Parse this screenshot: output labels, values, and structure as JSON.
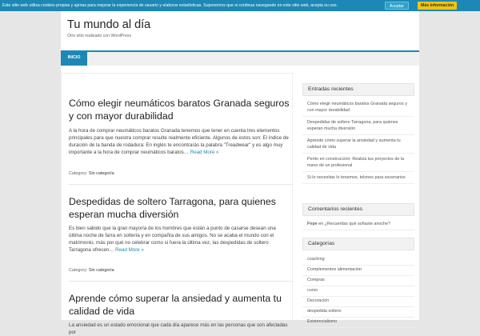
{
  "cookie": {
    "text": "Este sitio web utiliza cookies propias y ajenas para mejorar la experiencia de usuario y elaborar estadísticas. Suponemos que si continua navegando en este sitio web, acepta su uso.",
    "accept_label": "Aceptar",
    "info_label": "Más información"
  },
  "site": {
    "title": "Tu mundo al día",
    "description": "Otro sitio realizado con WordPress"
  },
  "nav": {
    "home_label": "INICIO"
  },
  "posts": [
    {
      "title": "Cómo elegir neumáticos baratos Granada seguros y con mayor durabilidad",
      "excerpt": "A la hora de comprar neumáticos baratos Granada tenemos que tener en cuenta tres elementos principales para que nuestra comprar resulte realmente eficiente. Algunos de estos son: El índice de duración de la banda de rodadura: En inglés te encontrarás la palabra \"Treadwear\" y es algo muy importante a la hora de comprar neumáticos baratos…",
      "read_more": "Read More »",
      "category_label": "Category:",
      "category": "Sin categoría"
    },
    {
      "title": "Despedidas de soltero Tarragona, para quienes esperan mucha diversión",
      "excerpt": "Es bien sabido que la gran mayoría de los hombres que están a punto de casarse desean una última noche de farra en soltería y en compañía de sus amigos. No se acaba el mundo con el matrimonio, más por qué no celebrar como si fuera la última vez, las despedidas de soltero Tarragona ofrecen…",
      "read_more": "Read More »",
      "category_label": "Category:",
      "category": "Sin categoría"
    },
    {
      "title": "Aprende cómo superar la ansiedad y aumenta tu calidad de vida",
      "excerpt": "La ansiedad es un estado emocional que cada día aparece más en las personas que son afectadas por"
    }
  ],
  "sidebar": {
    "recent_posts": {
      "heading": "Entradas recientes",
      "items": [
        "Cómo elegir neumáticos baratos Granada seguros y con mayor durabilidad",
        "Despedidas de soltero Tarragona, para quienes esperan mucha diversión",
        "Aprende cómo superar la ansiedad y aumenta tu calidad de vida",
        "Perito en construcción: Realiza tus proyectos de la mano de un profesional",
        "Si lo necesitas lo tenemos, telones para escenarios"
      ]
    },
    "recent_comments": {
      "heading": "Comentarios recientes",
      "commenter": "Pepe",
      "connector": "en",
      "post": "¿Recuerdas qué soñaste anoche?"
    },
    "categories": {
      "heading": "Categorías",
      "items": [
        "coaching",
        "Complementos alimentación",
        "Compras",
        "curso",
        "Decoración",
        "despedida soltero",
        "Existencialismo"
      ]
    }
  }
}
